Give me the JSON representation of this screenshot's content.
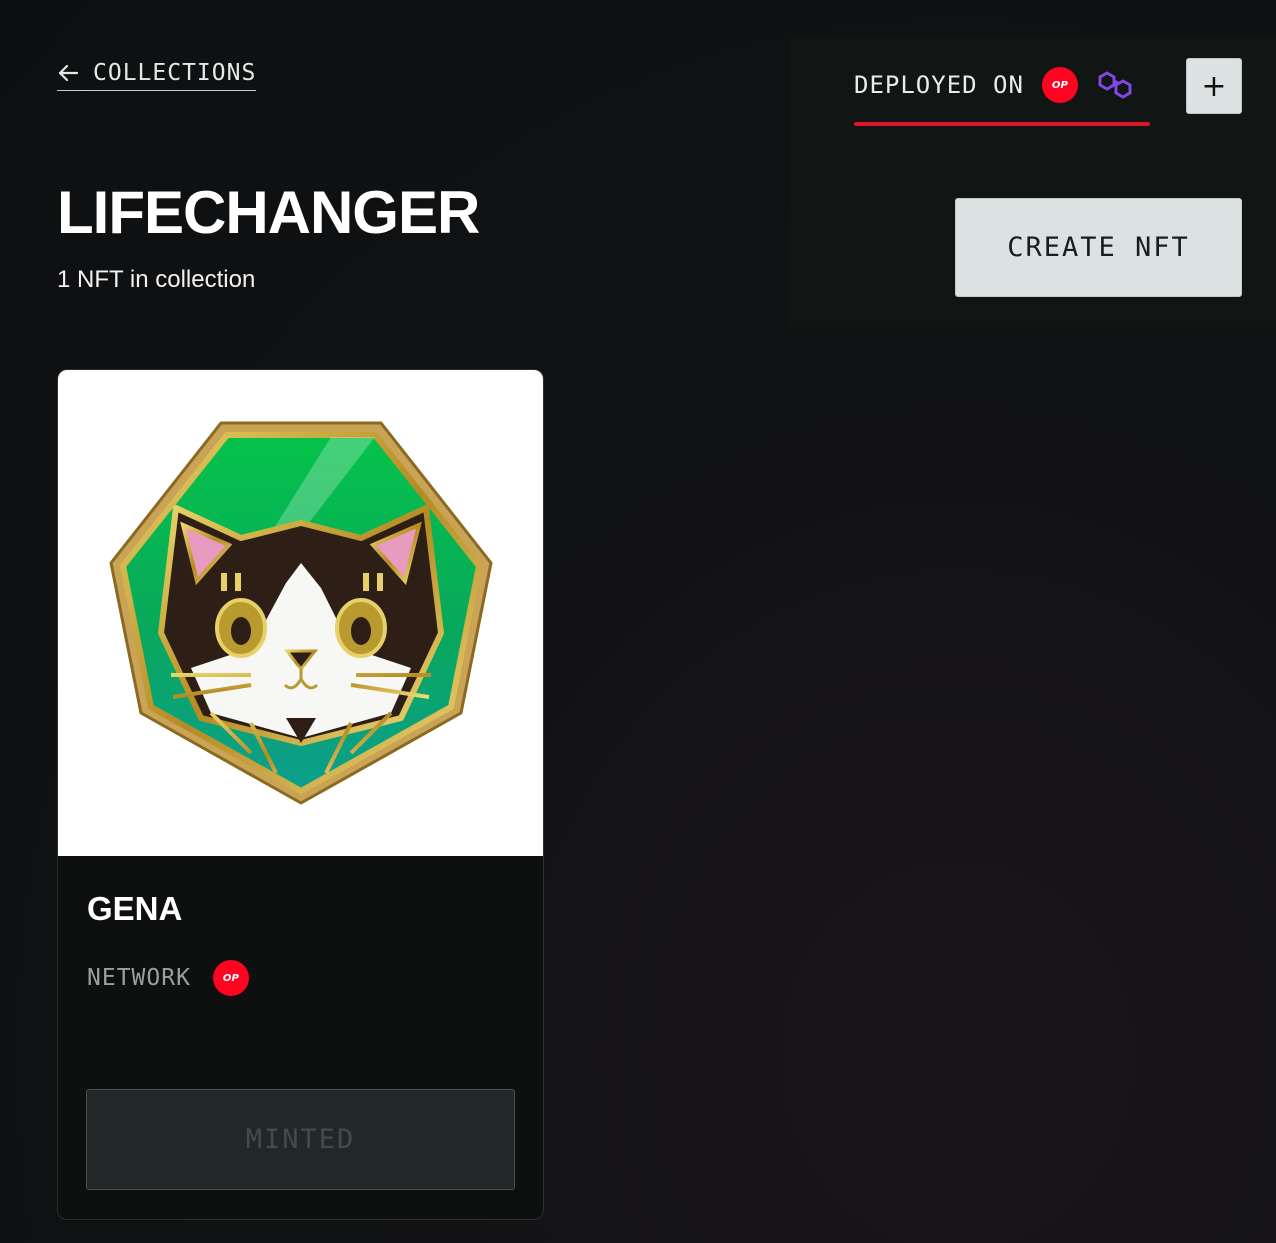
{
  "nav": {
    "back_label": "COLLECTIONS",
    "back_icon": "arrow-left-icon"
  },
  "collection": {
    "title": "LIFECHANGER",
    "subtitle": "1 NFT in collection"
  },
  "deployment": {
    "label": "DEPLOYED ON",
    "networks": [
      {
        "name": "optimism",
        "badge_text": "OP",
        "color": "#ff0420",
        "icon": "optimism-icon"
      },
      {
        "name": "polygon",
        "color": "#8247e5",
        "icon": "polygon-icon"
      }
    ],
    "active_indicator_color": "#e0142a",
    "add_button_label": "+"
  },
  "actions": {
    "create_label": "CREATE NFT"
  },
  "nfts": [
    {
      "name": "GENA",
      "network_label": "NETWORK",
      "network_badge": "OP",
      "status_label": "MINTED",
      "image_icon": "cat-badge-image"
    }
  ]
}
